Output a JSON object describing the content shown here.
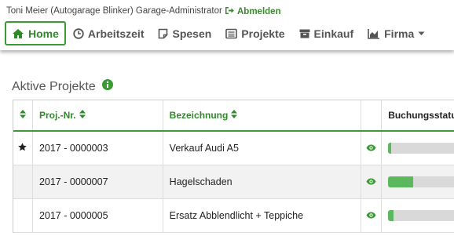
{
  "header": {
    "user": "Toni Meier (Autogarage Blinker) Garage-Administrator",
    "logout_label": "Abmelden"
  },
  "nav": {
    "items": [
      {
        "label": "Home",
        "icon": "home-icon"
      },
      {
        "label": "Arbeitszeit",
        "icon": "clock-icon"
      },
      {
        "label": "Spesen",
        "icon": "note-icon"
      },
      {
        "label": "Projekte",
        "icon": "list-icon"
      },
      {
        "label": "Einkauf",
        "icon": "archive-icon"
      },
      {
        "label": "Firma",
        "icon": "chart-icon"
      }
    ]
  },
  "section": {
    "title": "Aktive Projekte"
  },
  "table": {
    "columns": [
      "Proj.-Nr.",
      "Bezeichnung",
      "Buchungsstatus"
    ],
    "rows": [
      {
        "starred": true,
        "number": "2017 - 0000003",
        "name": "Verkauf Audi A5",
        "booking_status": 0.04
      },
      {
        "starred": false,
        "number": "2017 - 0000007",
        "name": "Hagelschaden",
        "booking_status": 0.33
      },
      {
        "starred": false,
        "number": "2017 - 0000005",
        "name": "Ersatz Abblendlicht + Teppiche",
        "booking_status": 0.07
      }
    ]
  },
  "colors": {
    "accent": "#3a9a33",
    "bar_fill": "#5cb85c",
    "bar_track": "#d9d9d9"
  }
}
